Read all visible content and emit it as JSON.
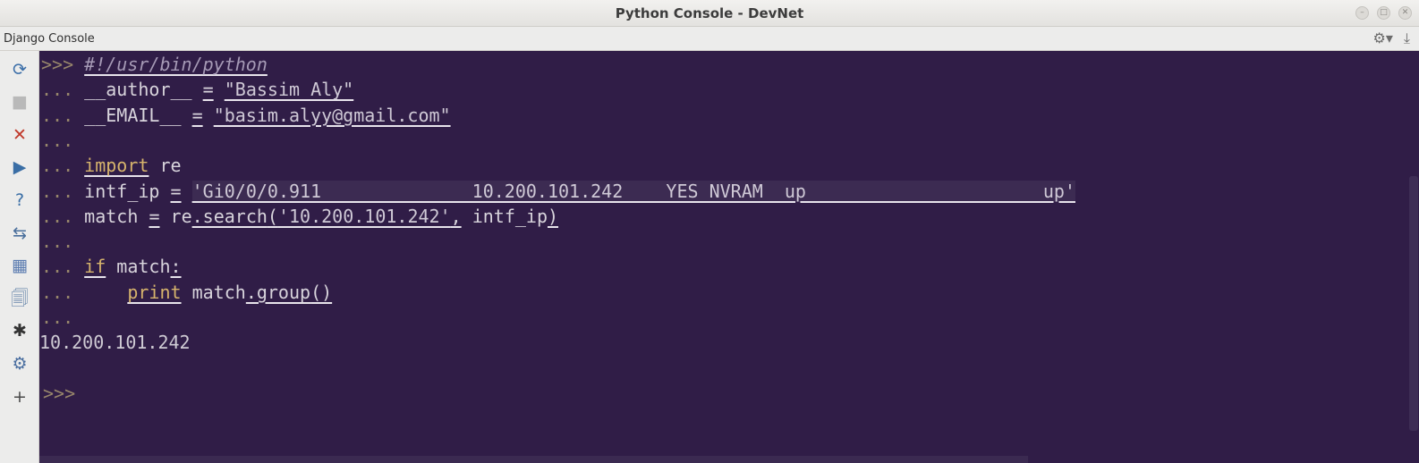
{
  "window": {
    "title": "Python Console - DevNet",
    "controls": [
      "minimize-icon",
      "maximize-icon",
      "close-icon"
    ]
  },
  "toolwindow": {
    "title": "Django Console",
    "right_icons": [
      "gear-icon",
      "hide-icon"
    ]
  },
  "toolbar": {
    "buttons": [
      {
        "name": "rerun-console-button",
        "icon": "rerun-icon",
        "glyph": "⟳"
      },
      {
        "name": "stop-button",
        "icon": "stop-icon",
        "glyph": "■"
      },
      {
        "name": "close-console-button",
        "icon": "close-icon",
        "glyph": "✕"
      },
      {
        "name": "execute-button",
        "icon": "play-icon",
        "glyph": "▶"
      },
      {
        "name": "help-button",
        "icon": "help-icon",
        "glyph": "?"
      },
      {
        "name": "settings-toggle-button",
        "icon": "settings-toggle-icon",
        "glyph": "⇆"
      },
      {
        "name": "variables-view-button",
        "icon": "variables-icon",
        "glyph": "▦"
      },
      {
        "name": "history-button",
        "icon": "history-icon",
        "glyph": "🗐"
      },
      {
        "name": "debug-button",
        "icon": "bug-icon",
        "glyph": "✱"
      },
      {
        "name": "console-settings-button",
        "icon": "gear-icon",
        "glyph": "⚙"
      },
      {
        "name": "new-console-button",
        "icon": "plus-icon",
        "glyph": "+"
      }
    ]
  },
  "console": {
    "lines": [
      {
        "prompt": ">>>",
        "segments": [
          {
            "text": "#!/usr/bin/python",
            "cls": "cm ul"
          }
        ]
      },
      {
        "prompt": "...",
        "segments": [
          {
            "text": "__author__",
            "cls": ""
          },
          {
            "text": " ",
            "cls": ""
          },
          {
            "text": "=",
            "cls": "ul"
          },
          {
            "text": " ",
            "cls": ""
          },
          {
            "text": "\"Bassim Aly\"",
            "cls": "st ul"
          }
        ]
      },
      {
        "prompt": "...",
        "segments": [
          {
            "text": "__EMAIL__",
            "cls": ""
          },
          {
            "text": " ",
            "cls": ""
          },
          {
            "text": "=",
            "cls": "ul"
          },
          {
            "text": " ",
            "cls": ""
          },
          {
            "text": "\"basim.alyy@gmail.com\"",
            "cls": "st ul"
          }
        ]
      },
      {
        "prompt": "...",
        "segments": []
      },
      {
        "prompt": "...",
        "segments": [
          {
            "text": "import",
            "cls": "kw ul"
          },
          {
            "text": " re",
            "cls": ""
          }
        ]
      },
      {
        "prompt": "...",
        "segments": [
          {
            "text": "intf_ip",
            "cls": ""
          },
          {
            "text": " ",
            "cls": ""
          },
          {
            "text": "=",
            "cls": "ul"
          },
          {
            "text": " ",
            "cls": ""
          },
          {
            "text": "'Gi0/0/0.911              10.200.101.242    YES NVRAM  up                      up'",
            "cls": "st ul hl"
          }
        ]
      },
      {
        "prompt": "...",
        "segments": [
          {
            "text": "match",
            "cls": ""
          },
          {
            "text": " ",
            "cls": ""
          },
          {
            "text": "=",
            "cls": "ul"
          },
          {
            "text": " re",
            "cls": ""
          },
          {
            "text": ".search",
            "cls": "ul"
          },
          {
            "text": "(",
            "cls": "ul"
          },
          {
            "text": "'10.200.101.242'",
            "cls": "st ul"
          },
          {
            "text": ",",
            "cls": "ul"
          },
          {
            "text": " intf_ip",
            "cls": ""
          },
          {
            "text": ")",
            "cls": "ul"
          }
        ]
      },
      {
        "prompt": "...",
        "segments": []
      },
      {
        "prompt": "...",
        "segments": [
          {
            "text": "if",
            "cls": "kw ul"
          },
          {
            "text": " match",
            "cls": ""
          },
          {
            "text": ":",
            "cls": "ul"
          }
        ]
      },
      {
        "prompt": "...",
        "segments": [
          {
            "text": "    ",
            "cls": ""
          },
          {
            "text": "print",
            "cls": "kw ul"
          },
          {
            "text": " match",
            "cls": ""
          },
          {
            "text": ".group",
            "cls": "ul"
          },
          {
            "text": "()",
            "cls": "ul"
          }
        ]
      },
      {
        "prompt": "...",
        "segments": []
      }
    ],
    "output": "10.200.101.242",
    "final_prompt": ">>>"
  },
  "colors": {
    "console_bg": "#301d47",
    "prompt": "#97866b",
    "keyword": "#d6b36c",
    "toolbar_bg": "#ececeb"
  }
}
